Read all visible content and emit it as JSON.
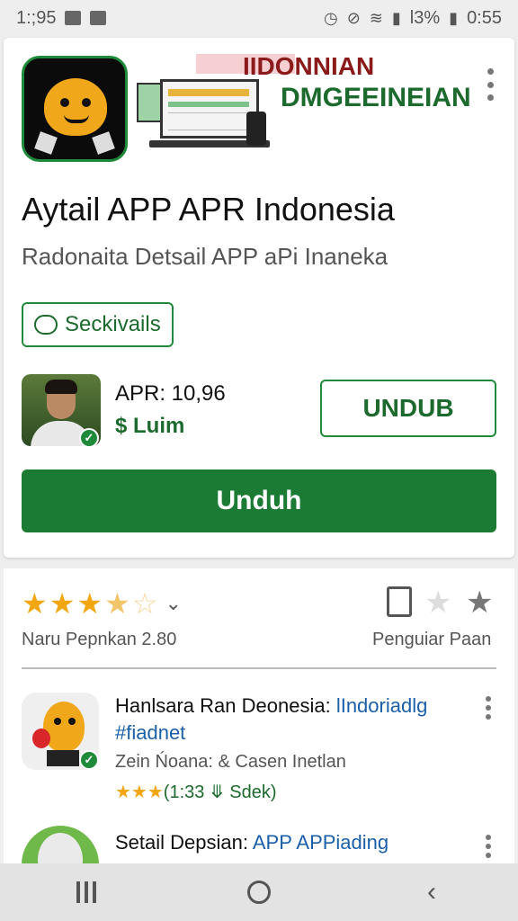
{
  "status_bar": {
    "time_left": "1:;95",
    "time_right": "0:55",
    "battery": "l3%"
  },
  "app": {
    "title": "Aytail APP APR Indonesia",
    "subtitle": "Radonaita Detsail APP aPi Inaneka",
    "tag_label": "Seckivails",
    "banner_line1": "IIDONNIAN",
    "banner_line2": "DMGEEINEIAN"
  },
  "developer": {
    "apr": "APR: 10,96",
    "price": "$ Luim"
  },
  "buttons": {
    "outline_label": "UNDUB",
    "primary_label": "Unduh"
  },
  "rating": {
    "label": "Naru Pepnkan 2.80",
    "value": 3.5,
    "max": 5
  },
  "actions": {
    "label": "Penguiar Paan"
  },
  "list_items": [
    {
      "title": "Hanlsara Ran Deonesia: ",
      "title_link": "lIndoriadlg",
      "title_link2": "#fiadnet",
      "subtitle": "Zein Ńoana: & Casen Inetlan",
      "rating_stars": "★★★",
      "rating_text": "(1:33 ⤋ Sdek)"
    },
    {
      "title": "Setail Depsian: ",
      "title_link": "APP APPiading"
    }
  ],
  "nav": {
    "recent": "recent-apps",
    "home": "home",
    "back": "back"
  }
}
